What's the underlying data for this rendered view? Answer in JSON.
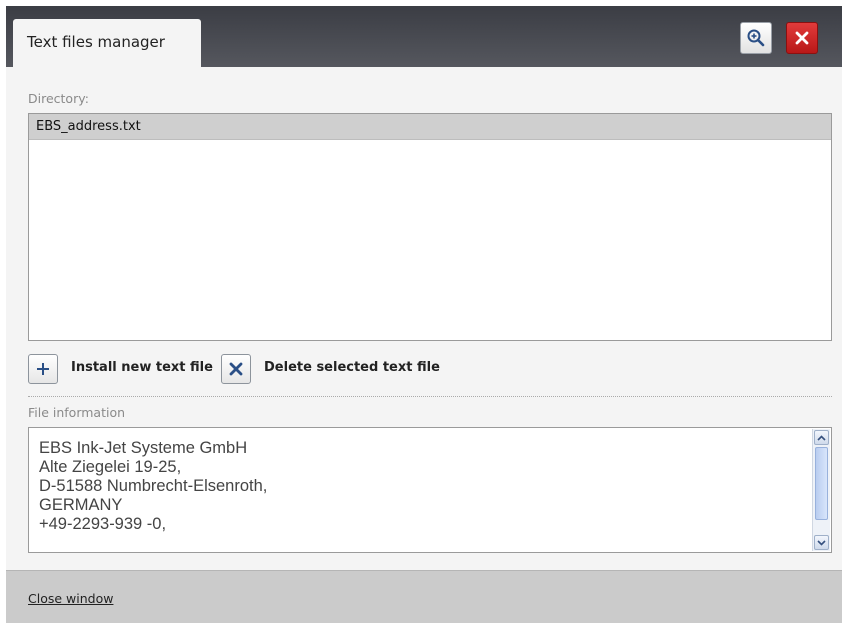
{
  "window": {
    "title": "Text files manager",
    "colors": {
      "titlebar": "#46484f",
      "close_button": "#cc2222",
      "panel": "#f4f4f4",
      "selection": "#cfcfcf"
    },
    "icons": {
      "zoom": "zoom-in-icon",
      "close": "close-icon"
    }
  },
  "directory": {
    "label": "Directory:",
    "files": [
      {
        "name": "EBS_address.txt",
        "selected": true
      }
    ]
  },
  "actions": {
    "install": {
      "icon": "plus-icon",
      "label": "Install new text file"
    },
    "delete": {
      "icon": "x-icon",
      "label": "Delete selected text file"
    }
  },
  "file_info": {
    "label": "File information",
    "lines": [
      "EBS Ink-Jet Systeme GmbH",
      "Alte Ziegelei 19-25,",
      "D-51588 Numbrecht-Elsenroth,",
      "GERMANY",
      "+49-2293-939 -0,"
    ]
  },
  "footer": {
    "close_label": "Close window"
  }
}
